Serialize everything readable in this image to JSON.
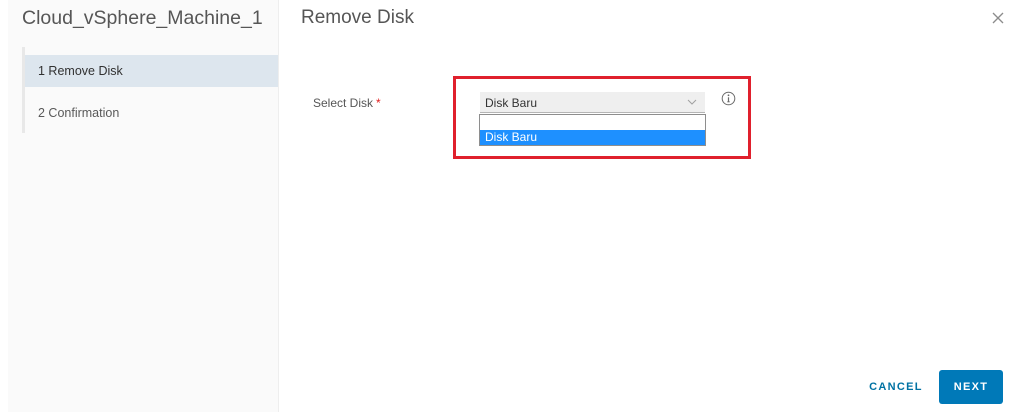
{
  "sidebar": {
    "title": "Cloud_vSphere_Machine_1",
    "steps": [
      {
        "label": "1 Remove Disk",
        "active": true
      },
      {
        "label": "2 Confirmation",
        "active": false
      }
    ]
  },
  "main": {
    "title": "Remove Disk",
    "field": {
      "label": "Select Disk",
      "required_mark": "*",
      "selected_value": "Disk Baru",
      "options": [
        "",
        "Disk Baru"
      ]
    }
  },
  "icons": {
    "close": "close-icon",
    "info": "info-icon",
    "chevron": "chevron-down-icon"
  },
  "footer": {
    "cancel_label": "CANCEL",
    "next_label": "NEXT"
  },
  "colors": {
    "accent": "#0079b8",
    "highlight": "#e0202d",
    "option_selected": "#1e90ff",
    "active_step": "#dde6ee"
  }
}
